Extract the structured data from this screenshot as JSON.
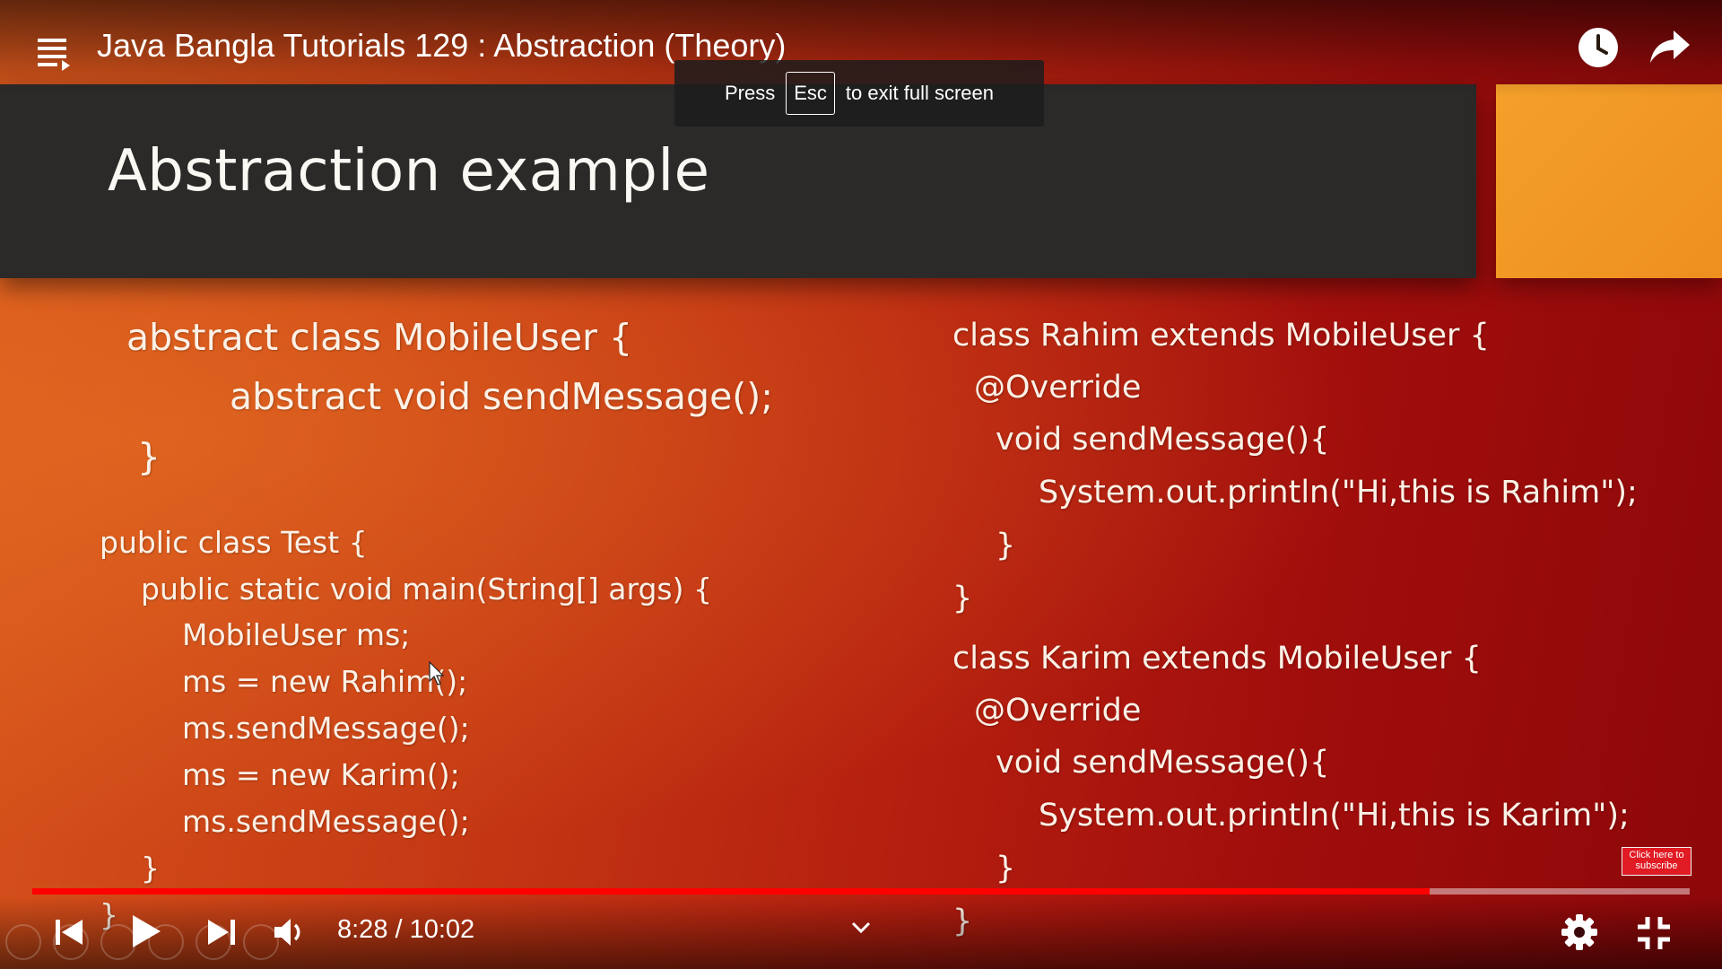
{
  "player": {
    "title": "Java Bangla Tutorials 129 : Abstraction (Theory)",
    "time_display": "8:28 / 10:02",
    "progress": 0.843
  },
  "toast": {
    "press": "Press",
    "key": "Esc",
    "rest": "to exit full screen"
  },
  "slide": {
    "title": "Abstraction example",
    "block_a": [
      "abstract class MobileUser {",
      "abstract void sendMessage();",
      "}"
    ],
    "block_b": [
      "public class Test {",
      "public static void main(String[] args) {",
      "MobileUser ms;",
      "ms = new Rahim();",
      "ms.sendMessage();",
      "ms = new Karim();",
      "ms.sendMessage();",
      "}",
      "}"
    ],
    "block_c": [
      "class Rahim extends MobileUser {",
      "@Override",
      "void sendMessage(){",
      "System.out.println(\"Hi,this is Rahim\");",
      "}",
      "}"
    ],
    "block_d": [
      "class Karim extends MobileUser {",
      "@Override",
      "void sendMessage(){",
      "System.out.println(\"Hi,this is Karim\");",
      "}",
      "}"
    ]
  },
  "subscribe": {
    "line1": "Click here to",
    "line2": "subscribe"
  },
  "icons": {
    "playlist": "playlist-icon",
    "watch_later": "clock-icon",
    "share": "share-icon",
    "previous": "skip-previous-icon",
    "play": "play-icon",
    "next": "skip-next-icon",
    "volume": "volume-icon",
    "chevron": "chevron-down-icon",
    "settings": "gear-icon",
    "exit_fullscreen": "exit-fullscreen-icon"
  },
  "colors": {
    "progress": "#ff0000",
    "accent_orange": "#f4a02a",
    "slide_header": "#2b2a29"
  }
}
